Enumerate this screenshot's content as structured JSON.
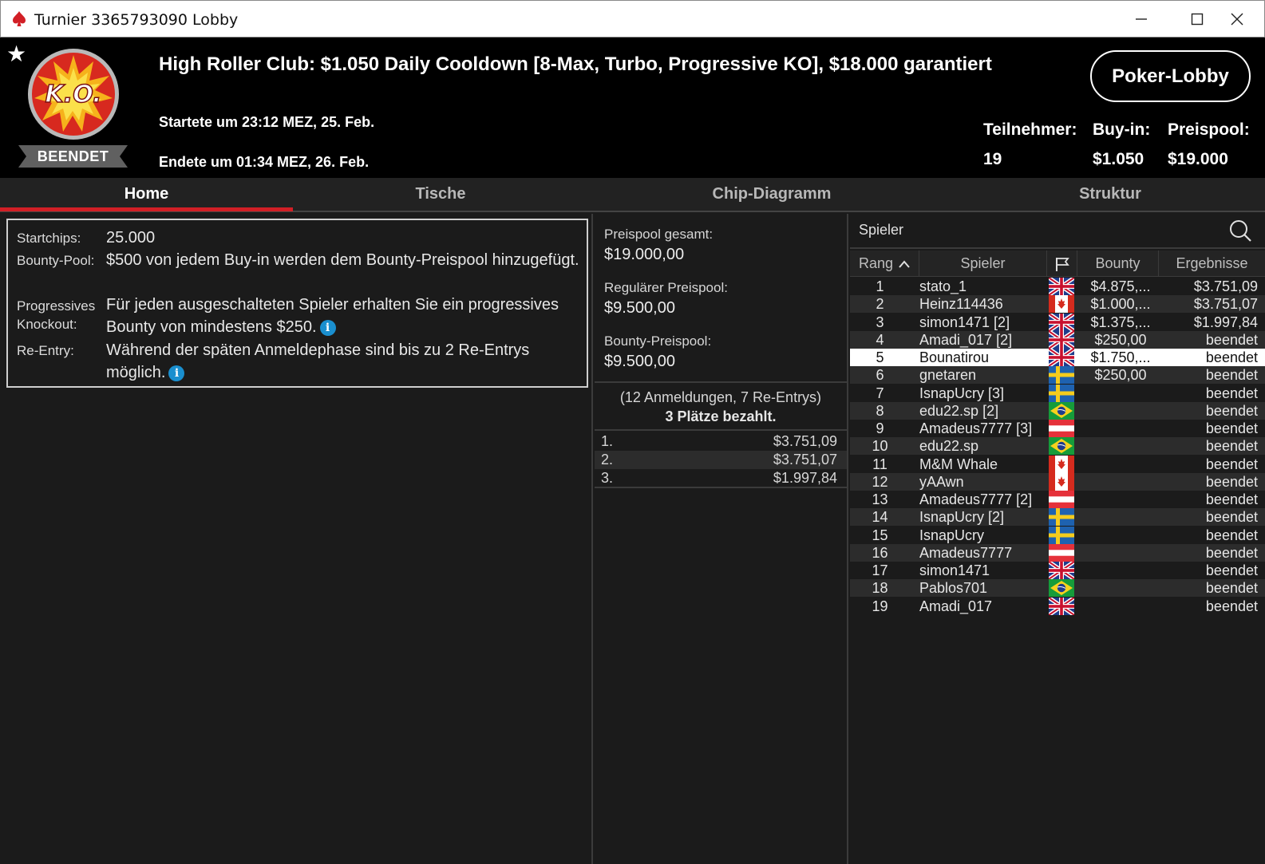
{
  "window": {
    "title": "Turnier 3365793090 Lobby",
    "minimize_icon": "minimize-icon",
    "maximize_icon": "maximize-icon",
    "close_icon": "close-icon"
  },
  "header": {
    "logo_text": "K.O.",
    "status": "BEENDET",
    "name": "High Roller Club: $1.050 Daily Cooldown [8-Max, Turbo, Progressive KO], $18.000 garantiert",
    "started": "Startete um 23:12 MEZ, 25. Feb.",
    "ended": "Endete um 01:34 MEZ, 26. Feb.",
    "lobby_button": "Poker-Lobby",
    "participants_label": "Teilnehmer:",
    "participants_value": "19",
    "buyin_label": "Buy-in:",
    "buyin_value": "$1.050",
    "prizepool_label": "Preispool:",
    "prizepool_value": "$19.000"
  },
  "tabs": [
    {
      "label": "Home",
      "active": true
    },
    {
      "label": "Tische",
      "active": false
    },
    {
      "label": "Chip-Diagramm",
      "active": false
    },
    {
      "label": "Struktur",
      "active": false
    }
  ],
  "info": {
    "startchips_label": "Startchips:",
    "startchips_value": "25.000",
    "bounty_label": "Bounty-Pool:",
    "bounty_value": "$500 von jedem Buy-in werden dem Bounty-Preispool hinzugefügt.",
    "pko_label_1": "Progressives",
    "pko_label_2": "Knockout:",
    "pko_value": "Für jeden ausgeschalteten Spieler erhalten Sie ein progressives Bounty von mindestens $250.",
    "reentry_label": "Re-Entry:",
    "reentry_value": "Während der späten Anmeldephase sind bis zu 2 Re-Entrys möglich."
  },
  "prizes": {
    "total_label": "Preispool gesamt:",
    "total_value": "$19.000,00",
    "regular_label": "Regulärer Preispool:",
    "regular_value": "$9.500,00",
    "bounty_label": "Bounty-Preispool:",
    "bounty_value": "$9.500,00",
    "entries": "(12 Anmeldungen, 7 Re-Entrys)",
    "paid": "3 Plätze bezahlt.",
    "payouts": [
      {
        "place": "1.",
        "amount": "$3.751,09"
      },
      {
        "place": "2.",
        "amount": "$3.751,07"
      },
      {
        "place": "3.",
        "amount": "$1.997,84"
      }
    ]
  },
  "players": {
    "search_label": "Spieler",
    "columns": {
      "rank": "Rang",
      "player": "Spieler",
      "bounty": "Bounty",
      "result": "Ergebnisse"
    },
    "rows": [
      {
        "rank": "1",
        "name": "stato_1",
        "flag": "uk",
        "bounty": "$4.875,...",
        "result": "$3.751,09"
      },
      {
        "rank": "2",
        "name": "Heinz114436",
        "flag": "ca",
        "bounty": "$1.000,...",
        "result": "$3.751,07"
      },
      {
        "rank": "3",
        "name": "simon1471 [2]",
        "flag": "uk",
        "bounty": "$1.375,...",
        "result": "$1.997,84"
      },
      {
        "rank": "4",
        "name": "Amadi_017 [2]",
        "flag": "uk",
        "bounty": "$250,00",
        "result": "beendet"
      },
      {
        "rank": "5",
        "name": "Bounatirou",
        "flag": "uk",
        "bounty": "$1.750,...",
        "result": "beendet",
        "selected": true
      },
      {
        "rank": "6",
        "name": "gnetaren",
        "flag": "se",
        "bounty": "$250,00",
        "result": "beendet"
      },
      {
        "rank": "7",
        "name": "IsnapUcry [3]",
        "flag": "se",
        "bounty": "",
        "result": "beendet"
      },
      {
        "rank": "8",
        "name": "edu22.sp [2]",
        "flag": "br",
        "bounty": "",
        "result": "beendet"
      },
      {
        "rank": "9",
        "name": "Amadeus7777 [3]",
        "flag": "at",
        "bounty": "",
        "result": "beendet"
      },
      {
        "rank": "10",
        "name": "edu22.sp",
        "flag": "br",
        "bounty": "",
        "result": "beendet"
      },
      {
        "rank": "11",
        "name": "M&M Whale",
        "flag": "ca",
        "bounty": "",
        "result": "beendet"
      },
      {
        "rank": "12",
        "name": "yAAwn",
        "flag": "ca",
        "bounty": "",
        "result": "beendet"
      },
      {
        "rank": "13",
        "name": "Amadeus7777 [2]",
        "flag": "at",
        "bounty": "",
        "result": "beendet"
      },
      {
        "rank": "14",
        "name": "IsnapUcry [2]",
        "flag": "se",
        "bounty": "",
        "result": "beendet"
      },
      {
        "rank": "15",
        "name": "IsnapUcry",
        "flag": "se",
        "bounty": "",
        "result": "beendet"
      },
      {
        "rank": "16",
        "name": "Amadeus7777",
        "flag": "at",
        "bounty": "",
        "result": "beendet"
      },
      {
        "rank": "17",
        "name": "simon1471",
        "flag": "uk",
        "bounty": "",
        "result": "beendet"
      },
      {
        "rank": "18",
        "name": "Pablos701",
        "flag": "br",
        "bounty": "",
        "result": "beendet"
      },
      {
        "rank": "19",
        "name": "Amadi_017",
        "flag": "uk",
        "bounty": "",
        "result": "beendet"
      }
    ]
  },
  "colors": {
    "accent_red": "#d21f26",
    "background": "#1b1b1b",
    "row_alt": "#2c2c2c",
    "info_icon": "#1a8fcf"
  }
}
